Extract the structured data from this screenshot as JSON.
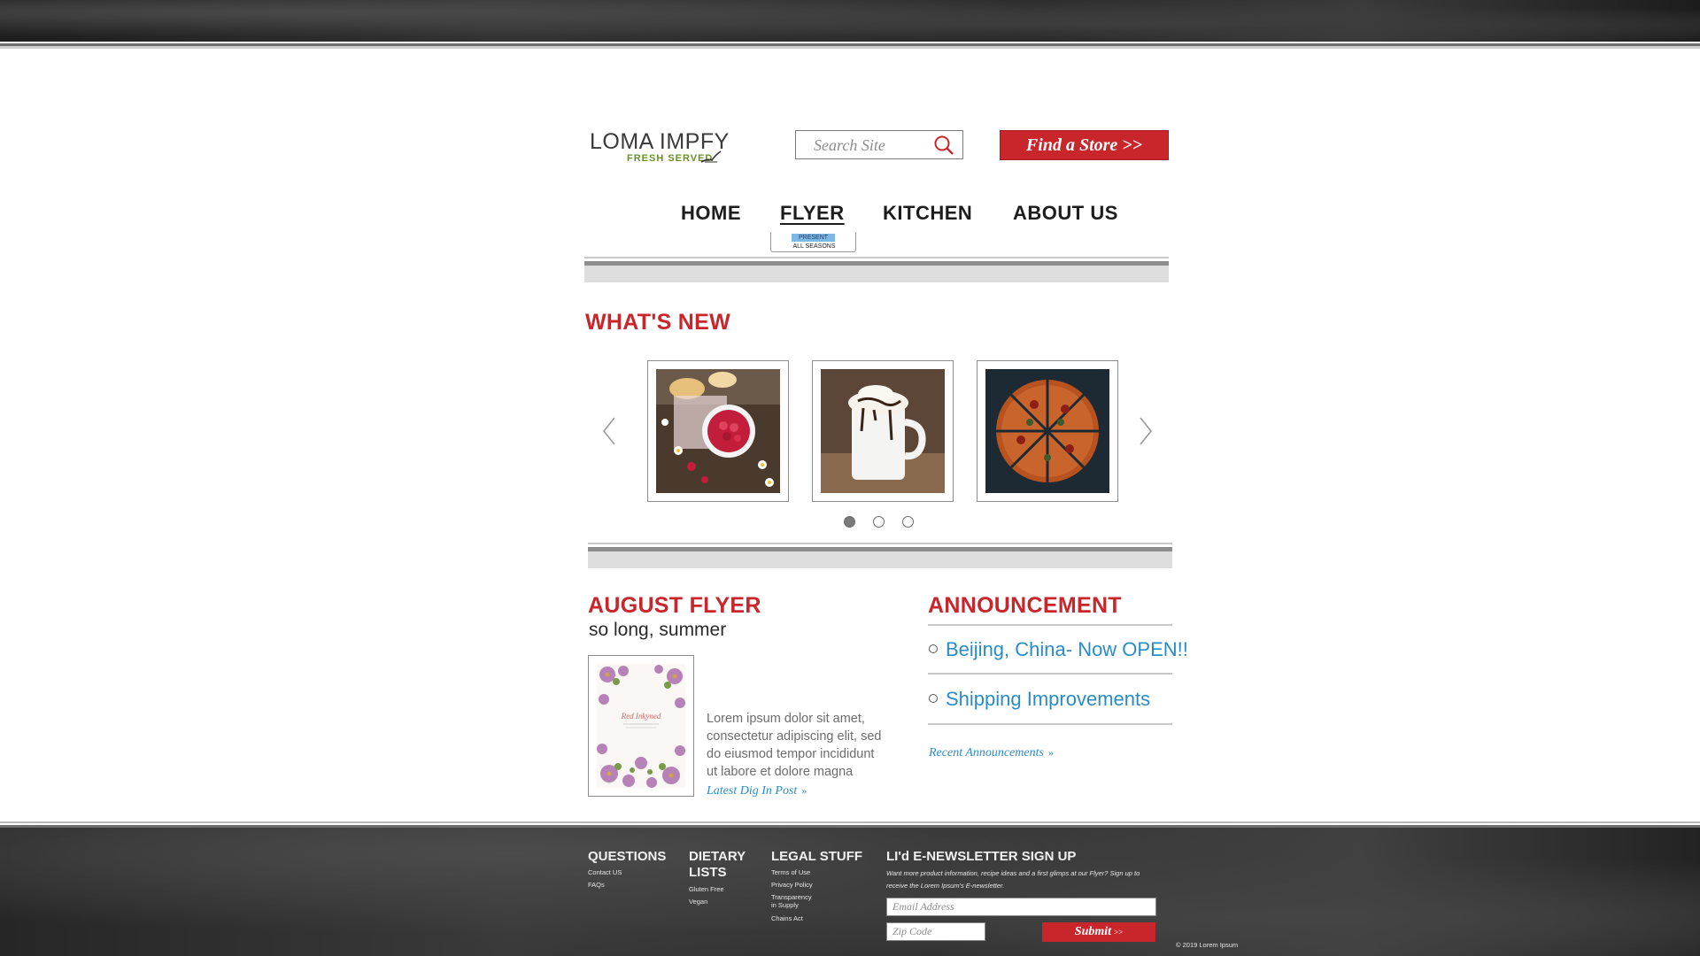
{
  "header": {
    "logo_brand": "LOMA IMPFY",
    "logo_tagline": "FRESH   SERVED",
    "search_placeholder": "Search Site",
    "find_store_label": "Find a Store >>"
  },
  "nav": {
    "items": [
      {
        "label": "HOME"
      },
      {
        "label": "FLYER",
        "active": true
      },
      {
        "label": "KITCHEN"
      },
      {
        "label": "ABOUT US"
      }
    ],
    "flyer_submenu": [
      "PRESENT",
      "ALL SEASONS"
    ]
  },
  "whats_new": {
    "title": "WHAT'S NEW",
    "slides": [
      {
        "icon": "raspberries-photo"
      },
      {
        "icon": "hot-chocolate-photo"
      },
      {
        "icon": "pizza-photo"
      }
    ],
    "dots": {
      "count": 3,
      "active_index": 0
    }
  },
  "flyer": {
    "title": "AUGUST FLYER",
    "subtitle": "so long, summer",
    "body_lines": [
      "Lorem ipsum dolor sit amet,",
      "consectetur adipiscing elit, sed",
      "do eiusmod tempor incididunt",
      "ut labore et dolore magna"
    ],
    "link_label": "Latest Dig In Post",
    "card_script_text": "Red  Inkyned"
  },
  "announcement": {
    "title": "ANNOUNCEMENT",
    "items": [
      {
        "label": "Beijing, China- Now OPEN!!"
      },
      {
        "label": "Shipping Improvements"
      }
    ],
    "link_label": "Recent Announcements"
  },
  "footer": {
    "questions": {
      "title": "QUESTIONS",
      "links": [
        "Contact US",
        "FAQs"
      ]
    },
    "dietary": {
      "title_line1": "DIETARY",
      "title_line2": "LISTS",
      "links": [
        "Gluten Free",
        "Vegan"
      ]
    },
    "legal": {
      "title": "LEGAL STUFF",
      "links": [
        "Terms of Use",
        "Privacy Policy",
        "Transparency",
        "in Supply",
        "Chains Act"
      ]
    },
    "newsletter": {
      "title": "LI'd E-NEWSLETTER SIGN UP",
      "desc_line1": "Want more product information, recipe ideas and a first glimps at our Flyer? Sign up to",
      "desc_line2": "receive the Lorem Ipsum's E-newsletter.",
      "email_placeholder": "Email Address",
      "zip_placeholder": "Zip Code",
      "submit_label": "Submit",
      "submit_chevron": ">>"
    },
    "copyright": "© 2019 Lorem Ipsum"
  },
  "colors": {
    "brand_red": "#c9262b",
    "link_blue": "#2a8cc7",
    "tagline_green": "#6b8f28"
  }
}
